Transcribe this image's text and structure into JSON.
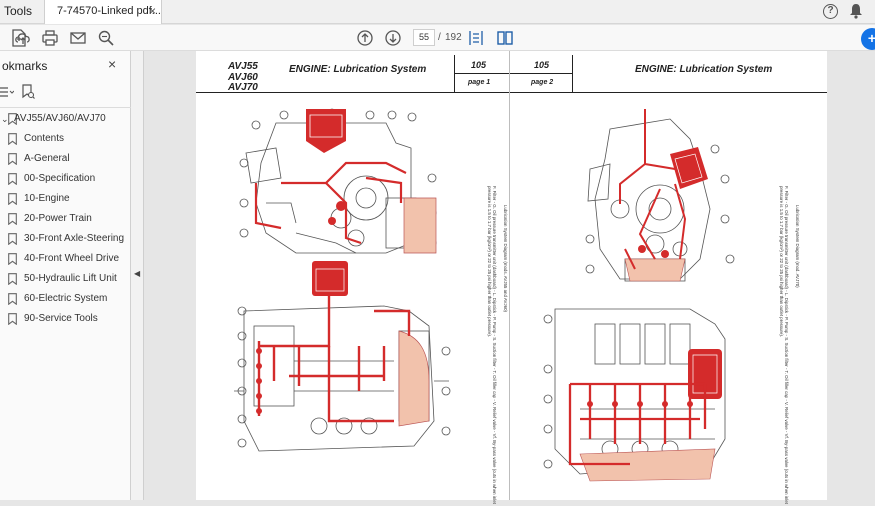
{
  "titlebar": {
    "tools_label": "Tools",
    "tab_title": "7-74570-Linked pdf...",
    "tab_close": "×",
    "help_glyph": "?"
  },
  "toolbar": {
    "current_page": "55",
    "page_separator": "/",
    "total_pages": "192",
    "share_glyph": "+"
  },
  "sidebar": {
    "title": "okmarks",
    "close_glyph": "×",
    "bookmarks": [
      {
        "label": "AVJ55/AVJ60/AVJ70",
        "has_chevron": true
      },
      {
        "label": "Contents"
      },
      {
        "label": "A-General"
      },
      {
        "label": "00-Specification"
      },
      {
        "label": "10-Engine"
      },
      {
        "label": "20-Power Train"
      },
      {
        "label": "30-Front Axle-Steering"
      },
      {
        "label": "40-Front Wheel Drive"
      },
      {
        "label": "50-Hydraulic Lift Unit"
      },
      {
        "label": "60-Electric System"
      },
      {
        "label": "90-Service Tools"
      }
    ]
  },
  "document": {
    "left_page": {
      "models": [
        "AVJ55",
        "AVJ60",
        "AVJ70"
      ],
      "title": "ENGINE: Lubrication System",
      "section": "105",
      "page_label": "page 1",
      "caption_heading": "Lubrication System Diagram (mods. AVJ55 and AVJ60)",
      "caption_body": "F. Filter - G. Oil pressure transmitter unit (dashboard) - L. Dipstick - P. Pump - S. Suction filter - T. Oil filler cap - V. Relief valve - Vf. By-pass valve (cuts in when inlet pressure is 1.5 to 1.7 bar (kg/cm²) or 22 to 25 psi higher than outlet pressure)."
    },
    "right_page": {
      "section": "105",
      "page_label": "page 2",
      "title": "ENGINE: Lubrication System",
      "caption_heading": "Lubrication System Diagram (mod. AVJ70)",
      "caption_body": "F. Filter - G. Oil pressure transmitter unit (dashboard) - L. Dipstick - P. Pump - S. Suction filter - T. Oil filler cap - V. Relief valve - Vf. By-pass valve (cuts in when inlet pressure is 1.5 to 1.7 bar (kg/cm²) or 22 to 25 psi higher than outlet pressure)."
    }
  },
  "colors": {
    "oil_red": "#d42b2b",
    "sump_pink": "#f2c2ac",
    "accent_blue": "#1473e6"
  }
}
